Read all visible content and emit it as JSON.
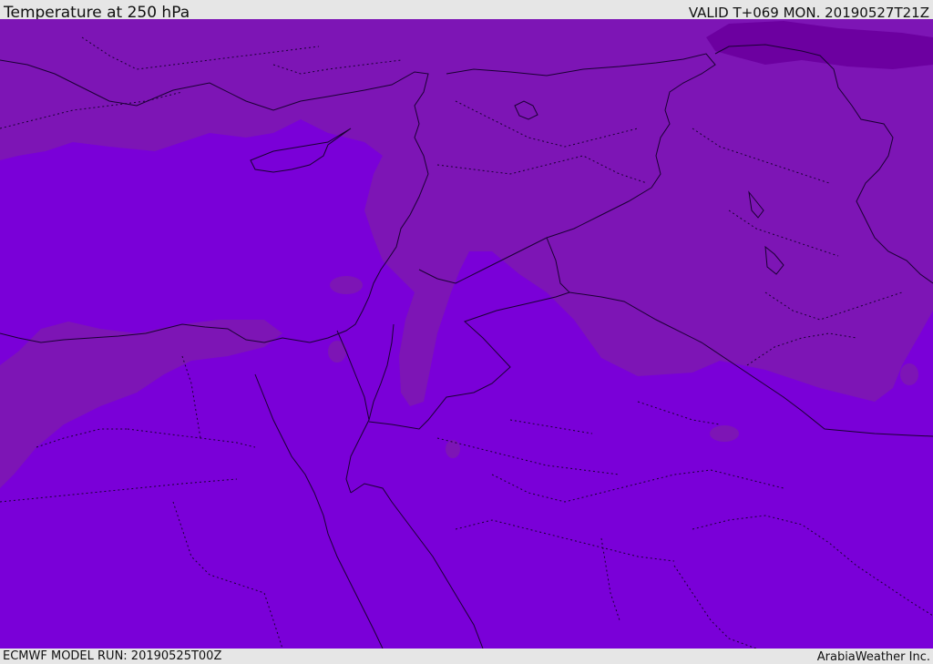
{
  "header": {
    "title": "Temperature at 250 hPa",
    "valid": "VALID T+069 MON. 20190527T21Z"
  },
  "footer": {
    "model_run": "ECMWF MODEL RUN: 20190525T00Z",
    "credit": "ArabiaWeather Inc."
  },
  "map": {
    "colors": {
      "field_main": "#7a00d8",
      "field_warm_band": "#7d15b5",
      "field_cold_patch": "#6c00a0",
      "coastline": "#1a0033"
    }
  }
}
